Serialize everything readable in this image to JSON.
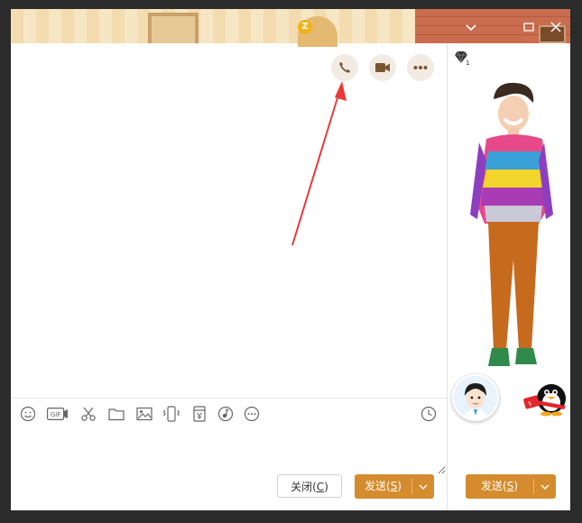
{
  "titlebar": {
    "badge": "Z",
    "controls": [
      "chevron-down-icon",
      "restore-icon",
      "close-icon"
    ]
  },
  "header_actions": [
    {
      "name": "voice-call-button",
      "icon": "phone-icon"
    },
    {
      "name": "video-call-button",
      "icon": "video-camera-icon"
    },
    {
      "name": "more-button",
      "icon": "more-dots-icon"
    }
  ],
  "toolbar": [
    "emoji-icon",
    "gif-icon",
    "scissors-icon",
    "folder-icon",
    "image-icon",
    "shake-icon",
    "red-packet-icon",
    "music-icon",
    "more-circle-icon",
    "history-clock-icon"
  ],
  "footer": {
    "close_label": "关闭(",
    "close_key": "C",
    "close_suffix": ")",
    "send_label": "发送(",
    "send_key": "S",
    "send_suffix": ")"
  },
  "colors": {
    "accent": "#d48c2e",
    "arrow": "#e83a3a"
  }
}
